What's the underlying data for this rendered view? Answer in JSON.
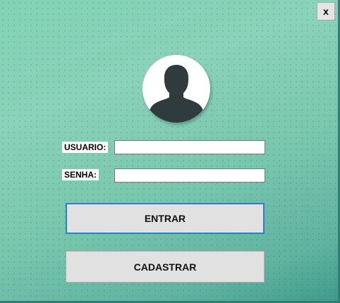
{
  "window": {
    "close_label": "x"
  },
  "login": {
    "avatar_icon": "user-silhouette-icon",
    "username_label": "USUARIO:",
    "username_value": "",
    "password_label": "SENHA:",
    "password_value": "",
    "enter_button": "ENTRAR",
    "register_button": "CADASTRAR"
  },
  "colors": {
    "background": "#7ccbb0",
    "background_dark": "#3f9a8a",
    "button_face": "#e1e1e1",
    "focus_border": "#2a7fcf",
    "avatar_figure": "#2f3b3c"
  }
}
